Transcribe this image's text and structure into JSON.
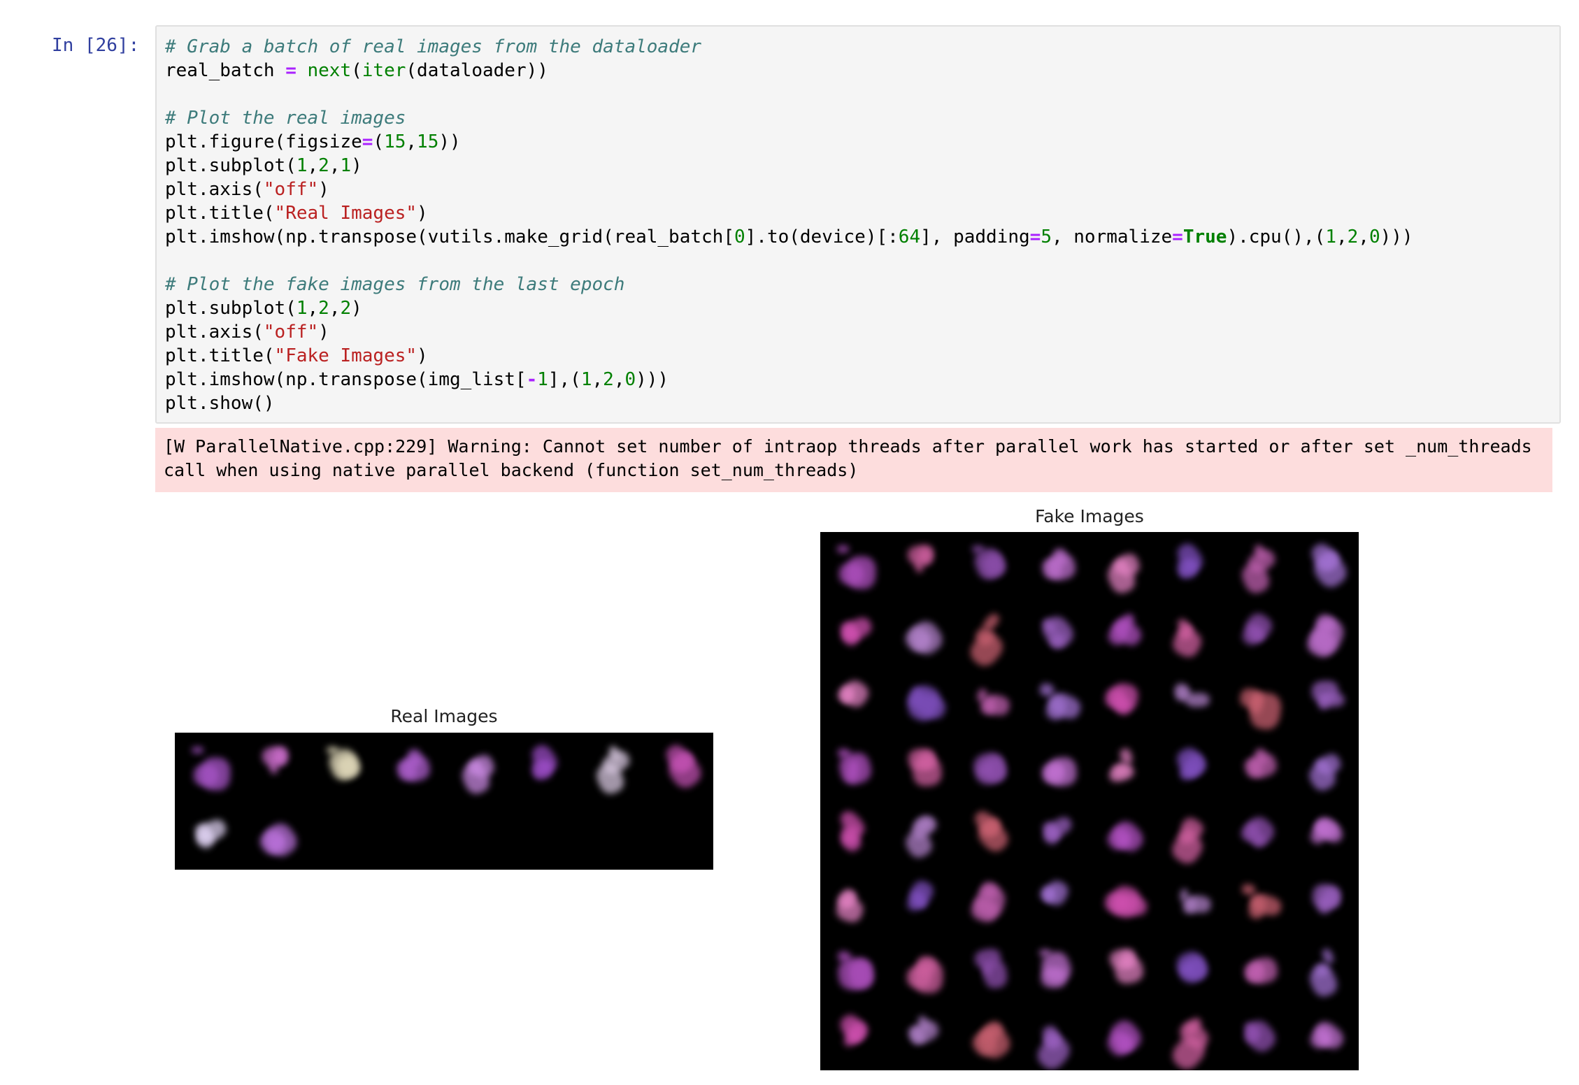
{
  "cell": {
    "prompt": "In [26]:",
    "code_lines": [
      [
        {
          "t": "# Grab a batch of real images from the dataloader",
          "c": "c"
        }
      ],
      [
        {
          "t": "real_batch "
        },
        {
          "t": "=",
          "c": "o"
        },
        {
          "t": " "
        },
        {
          "t": "next",
          "c": "b"
        },
        {
          "t": "("
        },
        {
          "t": "iter",
          "c": "b"
        },
        {
          "t": "(dataloader))"
        }
      ],
      [],
      [
        {
          "t": "# Plot the real images",
          "c": "c"
        }
      ],
      [
        {
          "t": "plt.figure(figsize"
        },
        {
          "t": "=",
          "c": "o"
        },
        {
          "t": "("
        },
        {
          "t": "15",
          "c": "n"
        },
        {
          "t": ","
        },
        {
          "t": "15",
          "c": "n"
        },
        {
          "t": "))"
        }
      ],
      [
        {
          "t": "plt.subplot("
        },
        {
          "t": "1",
          "c": "n"
        },
        {
          "t": ","
        },
        {
          "t": "2",
          "c": "n"
        },
        {
          "t": ","
        },
        {
          "t": "1",
          "c": "n"
        },
        {
          "t": ")"
        }
      ],
      [
        {
          "t": "plt.axis("
        },
        {
          "t": "\"off\"",
          "c": "s"
        },
        {
          "t": ")"
        }
      ],
      [
        {
          "t": "plt.title("
        },
        {
          "t": "\"Real Images\"",
          "c": "s"
        },
        {
          "t": ")"
        }
      ],
      [
        {
          "t": "plt.imshow(np.transpose(vutils.make_grid(real_batch["
        },
        {
          "t": "0",
          "c": "n"
        },
        {
          "t": "].to(device)[:"
        },
        {
          "t": "64",
          "c": "n"
        },
        {
          "t": "], padding"
        },
        {
          "t": "=",
          "c": "o"
        },
        {
          "t": "5",
          "c": "n"
        },
        {
          "t": ", normalize"
        },
        {
          "t": "=",
          "c": "o"
        },
        {
          "t": "True",
          "c": "k"
        },
        {
          "t": ").cpu(),("
        },
        {
          "t": "1",
          "c": "n"
        },
        {
          "t": ","
        },
        {
          "t": "2",
          "c": "n"
        },
        {
          "t": ","
        },
        {
          "t": "0",
          "c": "n"
        },
        {
          "t": ")))"
        }
      ],
      [],
      [
        {
          "t": "# Plot the fake images from the last epoch",
          "c": "c"
        }
      ],
      [
        {
          "t": "plt.subplot("
        },
        {
          "t": "1",
          "c": "n"
        },
        {
          "t": ","
        },
        {
          "t": "2",
          "c": "n"
        },
        {
          "t": ","
        },
        {
          "t": "2",
          "c": "n"
        },
        {
          "t": ")"
        }
      ],
      [
        {
          "t": "plt.axis("
        },
        {
          "t": "\"off\"",
          "c": "s"
        },
        {
          "t": ")"
        }
      ],
      [
        {
          "t": "plt.title("
        },
        {
          "t": "\"Fake Images\"",
          "c": "s"
        },
        {
          "t": ")"
        }
      ],
      [
        {
          "t": "plt.imshow(np.transpose(img_list["
        },
        {
          "t": "-",
          "c": "o"
        },
        {
          "t": "1",
          "c": "n"
        },
        {
          "t": "],("
        },
        {
          "t": "1",
          "c": "n"
        },
        {
          "t": ","
        },
        {
          "t": "2",
          "c": "n"
        },
        {
          "t": ","
        },
        {
          "t": "0",
          "c": "n"
        },
        {
          "t": ")))"
        }
      ],
      [
        {
          "t": "plt.show()"
        }
      ]
    ]
  },
  "output": {
    "stderr_text": "[W ParallelNative.cpp:229] Warning: Cannot set number of intraop threads after parallel work has started or after set _num_threads call when using native parallel backend (function set_num_threads)",
    "real_images": {
      "title": "Real Images",
      "grid": {
        "cols": 8,
        "rows": 2,
        "filled": 10
      },
      "palette": [
        "#a855c8",
        "#d070d0",
        "#e8e0c0",
        "#b060d0",
        "#c888e0",
        "#9a4cc4",
        "#d8c8e0",
        "#c050b0",
        "#ddd0f0",
        "#b870d8"
      ]
    },
    "fake_images": {
      "title": "Fake Images",
      "grid": {
        "cols": 8,
        "rows": 8
      },
      "palette": [
        "#b050c0",
        "#d060a0",
        "#9050b0",
        "#c070d0",
        "#e080c0",
        "#8050c0",
        "#c060b0",
        "#a070d0",
        "#d050b0",
        "#b080c8",
        "#c86070",
        "#9a60c0"
      ]
    }
  }
}
